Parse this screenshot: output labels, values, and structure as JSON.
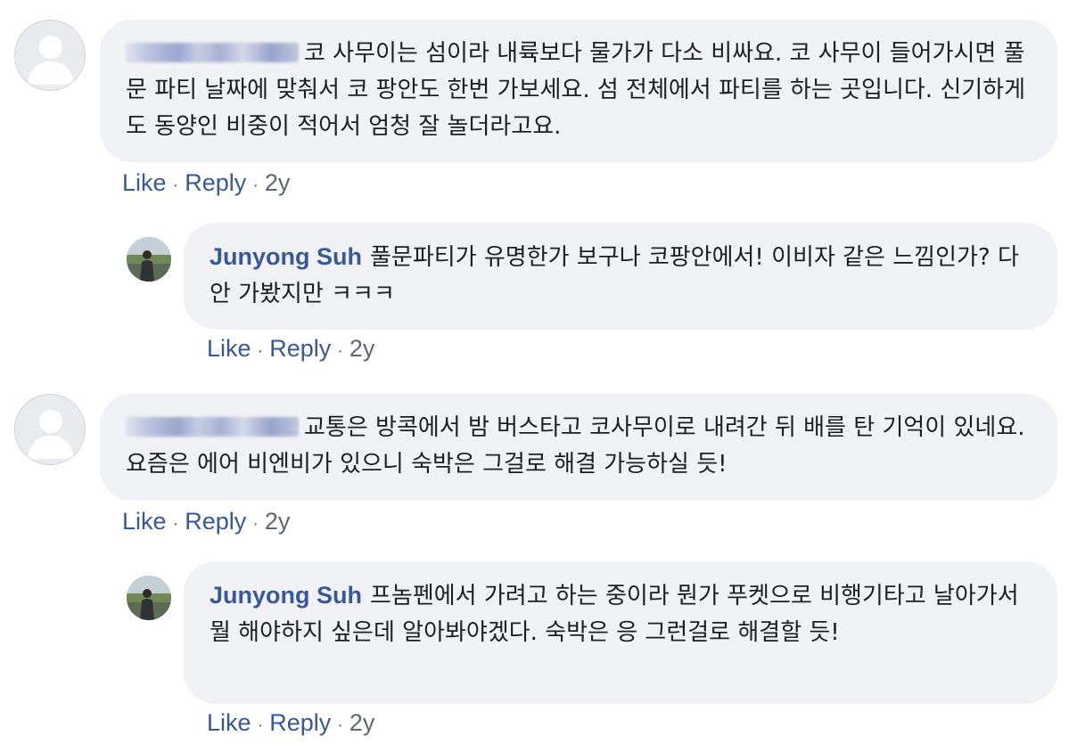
{
  "comments": [
    {
      "author": "",
      "author_blurred": true,
      "avatar": "default-user-icon",
      "text": "코 사무이는 섬이라 내륙보다 물가가 다소 비싸요. 코 사무이 들어가시면 풀 문 파티 날짜에 맞춰서 코 팡안도 한번 가보세요. 섬 전체에서 파티를 하는 곳입니다. 신기하게도 동양인 비중이 적어서 엄청 잘 놀더라고요.",
      "like": "Like",
      "reply": "Reply",
      "time": "2y"
    },
    {
      "author": "Junyong Suh",
      "avatar": "profile-photo",
      "text": "풀문파티가 유명한가 보구나 코팡안에서! 이비자 같은 느낌인가? 다 안 가봤지만 ㅋㅋㅋ",
      "like": "Like",
      "reply": "Reply",
      "time": "2y"
    },
    {
      "author": "",
      "author_blurred": true,
      "avatar": "default-user-icon",
      "text": "교통은 방콕에서 밤 버스타고 코사무이로 내려간 뒤 배를 탄 기억이 있네요. 요즘은 에어 비엔비가 있으니 숙박은 그걸로 해결 가능하실 듯!",
      "like": "Like",
      "reply": "Reply",
      "time": "2y"
    },
    {
      "author": "Junyong Suh",
      "avatar": "profile-photo",
      "text": "프놈펜에서 가려고 하는 중이라 뭔가 푸켓으로 비행기타고 날아가서 뭘 해야하지 싶은데 알아봐야겠다. 숙박은 응 그런걸로 해결할 듯!",
      "like": "Like",
      "reply": "Reply",
      "time": "2y"
    }
  ],
  "separator": "·",
  "colors": {
    "bubble": "#f0f2f5",
    "link": "#385898",
    "meta": "#606770",
    "text": "#1c1e21"
  }
}
